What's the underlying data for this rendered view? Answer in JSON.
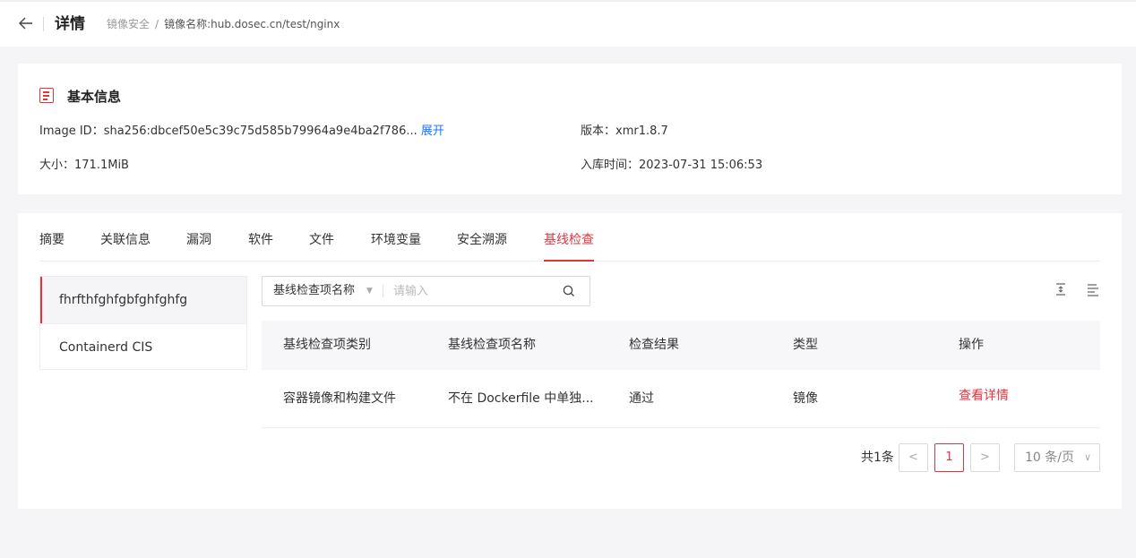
{
  "header": {
    "back_icon": "arrow-left-icon",
    "title": "详情",
    "breadcrumb": [
      "镜像安全",
      "镜像名称:hub.dosec.cn/test/nginx"
    ],
    "separator": "/"
  },
  "info": {
    "section_title": "基本信息",
    "section_icon": "document-icon",
    "image_id_label": "Image ID：",
    "image_id_value": "sha256:dbcef50e5c39c75d585b79964a9e4ba2f786...",
    "expand_link": "展开",
    "version_label": "版本：",
    "version_value": "xmr1.8.7",
    "size_label": "大小：",
    "size_value": "171.1MiB",
    "ingest_label": "入库时间：",
    "ingest_value": "2023-07-31 15:06:53"
  },
  "tabs": [
    {
      "label": "摘要",
      "active": false
    },
    {
      "label": "关联信息",
      "active": false
    },
    {
      "label": "漏洞",
      "active": false
    },
    {
      "label": "软件",
      "active": false
    },
    {
      "label": "文件",
      "active": false
    },
    {
      "label": "环境变量",
      "active": false
    },
    {
      "label": "安全溯源",
      "active": false
    },
    {
      "label": "基线检查",
      "active": true
    }
  ],
  "side_list": [
    {
      "label": "fhrfthfghfgbfghfghfg",
      "active": true
    },
    {
      "label": "Containerd CIS",
      "active": false
    }
  ],
  "search": {
    "select_value": "基线检查项名称",
    "placeholder": "请输入",
    "value": ""
  },
  "toolbar_icons": [
    "vertical-expand-icon",
    "align-left-icon"
  ],
  "table": {
    "columns": [
      "基线检查项类别",
      "基线检查项名称",
      "检查结果",
      "类型",
      "操作"
    ],
    "rows": [
      {
        "category": "容器镜像和构建文件",
        "name": "不在 Dockerfile 中单独...",
        "result": "通过",
        "type": "镜像",
        "action": "查看详情"
      }
    ]
  },
  "pagination": {
    "total_text": "共1条",
    "prev": "<",
    "current_page": "1",
    "next": ">",
    "page_size": "10 条/页"
  },
  "colors": {
    "accent": "#e0353f",
    "link": "#1677ff",
    "page_bg": "#f5f5f7"
  }
}
